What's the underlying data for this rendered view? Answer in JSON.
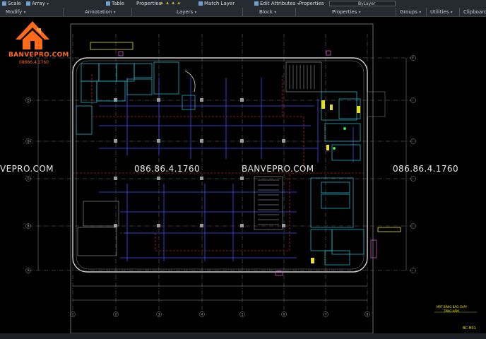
{
  "ribbon": {
    "top_items": [
      "Scale",
      "Array",
      "Table",
      "Properties",
      "Match Layer",
      "Edit Attributes",
      "Properties"
    ],
    "panels": [
      "Modify",
      "Annotation",
      "Layers",
      "Block",
      "Properties",
      "Groups",
      "Utilities",
      "Clipboard"
    ],
    "bylayer": "ByLayer"
  },
  "logo": {
    "brand": "BANVEPRO.COM",
    "phone": "08686.4.1760"
  },
  "watermarks": [
    "VEPRO.COM",
    "086.86.4.1760",
    "BANVEPRO.COM",
    "086.86.4.1760"
  ],
  "drawing": {
    "grid_cols": [
      "1",
      "2",
      "3",
      "4",
      "5",
      "6",
      "7",
      "8"
    ],
    "grid_rows": [
      "A",
      "B",
      "C",
      "D",
      "E",
      "F"
    ],
    "sheet_title": "MẶT BẰNG BÁO CHÁY",
    "sheet_subtitle": "TẦNG HẦM",
    "sheet_code": "BC-H01"
  },
  "colors": {
    "ribbon_bg": "#262b31",
    "cad_bg": "#000000",
    "wall": "#cfcfcf",
    "pipe": "#3f4dff",
    "dash": "#ff3030",
    "cyan": "#27c4d8",
    "yellow": "#e8e020",
    "magenta": "#d34fd3"
  }
}
